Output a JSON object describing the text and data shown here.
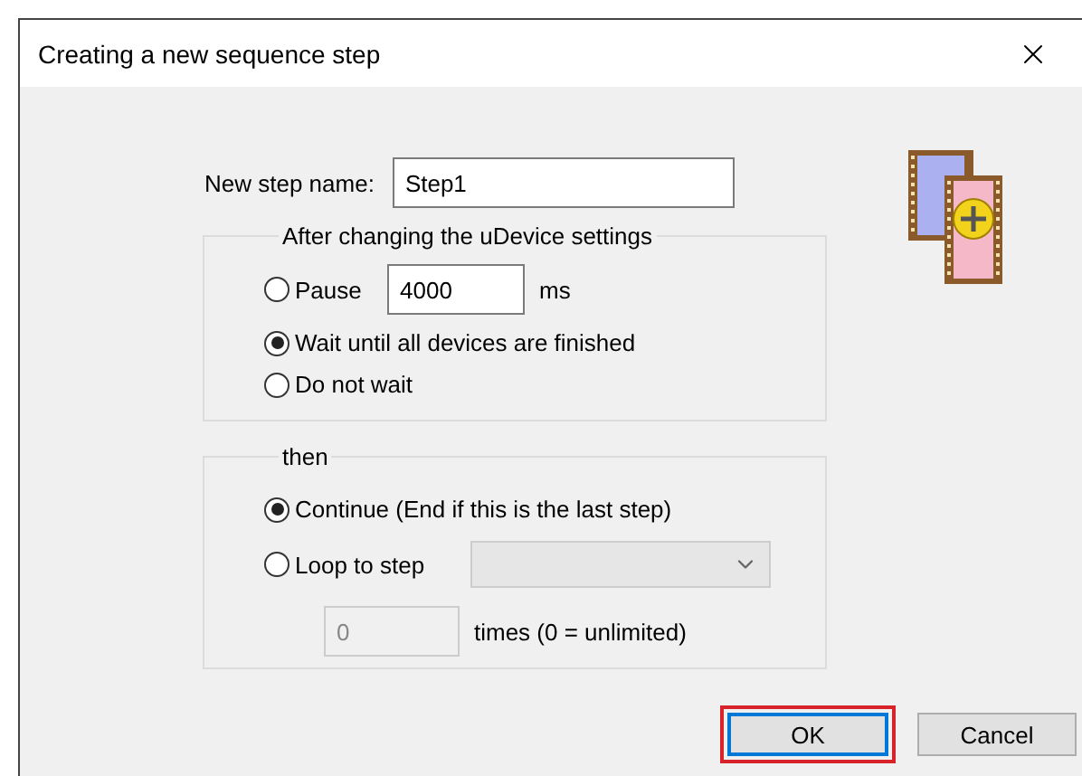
{
  "window": {
    "title": "Creating a new sequence step"
  },
  "step_name": {
    "label": "New step name:",
    "value": "Step1"
  },
  "wait_group": {
    "legend": "After changing the uDevice settings",
    "options": [
      {
        "kind": "pause",
        "label": "Pause",
        "selected": false,
        "value": "4000",
        "unit": "ms"
      },
      {
        "kind": "plain",
        "label": "Wait until all devices are finished",
        "selected": true
      },
      {
        "kind": "plain",
        "label": "Do not wait",
        "selected": false
      }
    ]
  },
  "then_group": {
    "legend": "then",
    "options": [
      {
        "kind": "plain",
        "label": "Continue (End if this is the last step)",
        "selected": true
      },
      {
        "kind": "loop",
        "label": "Loop to step",
        "selected": false,
        "disabled": true,
        "times_value": "0",
        "times_label": "times (0 = unlimited)"
      }
    ]
  },
  "buttons": [
    {
      "label": "OK",
      "focused": true,
      "highlighted": true
    },
    {
      "label": "Cancel",
      "focused": false,
      "highlighted": false
    }
  ]
}
